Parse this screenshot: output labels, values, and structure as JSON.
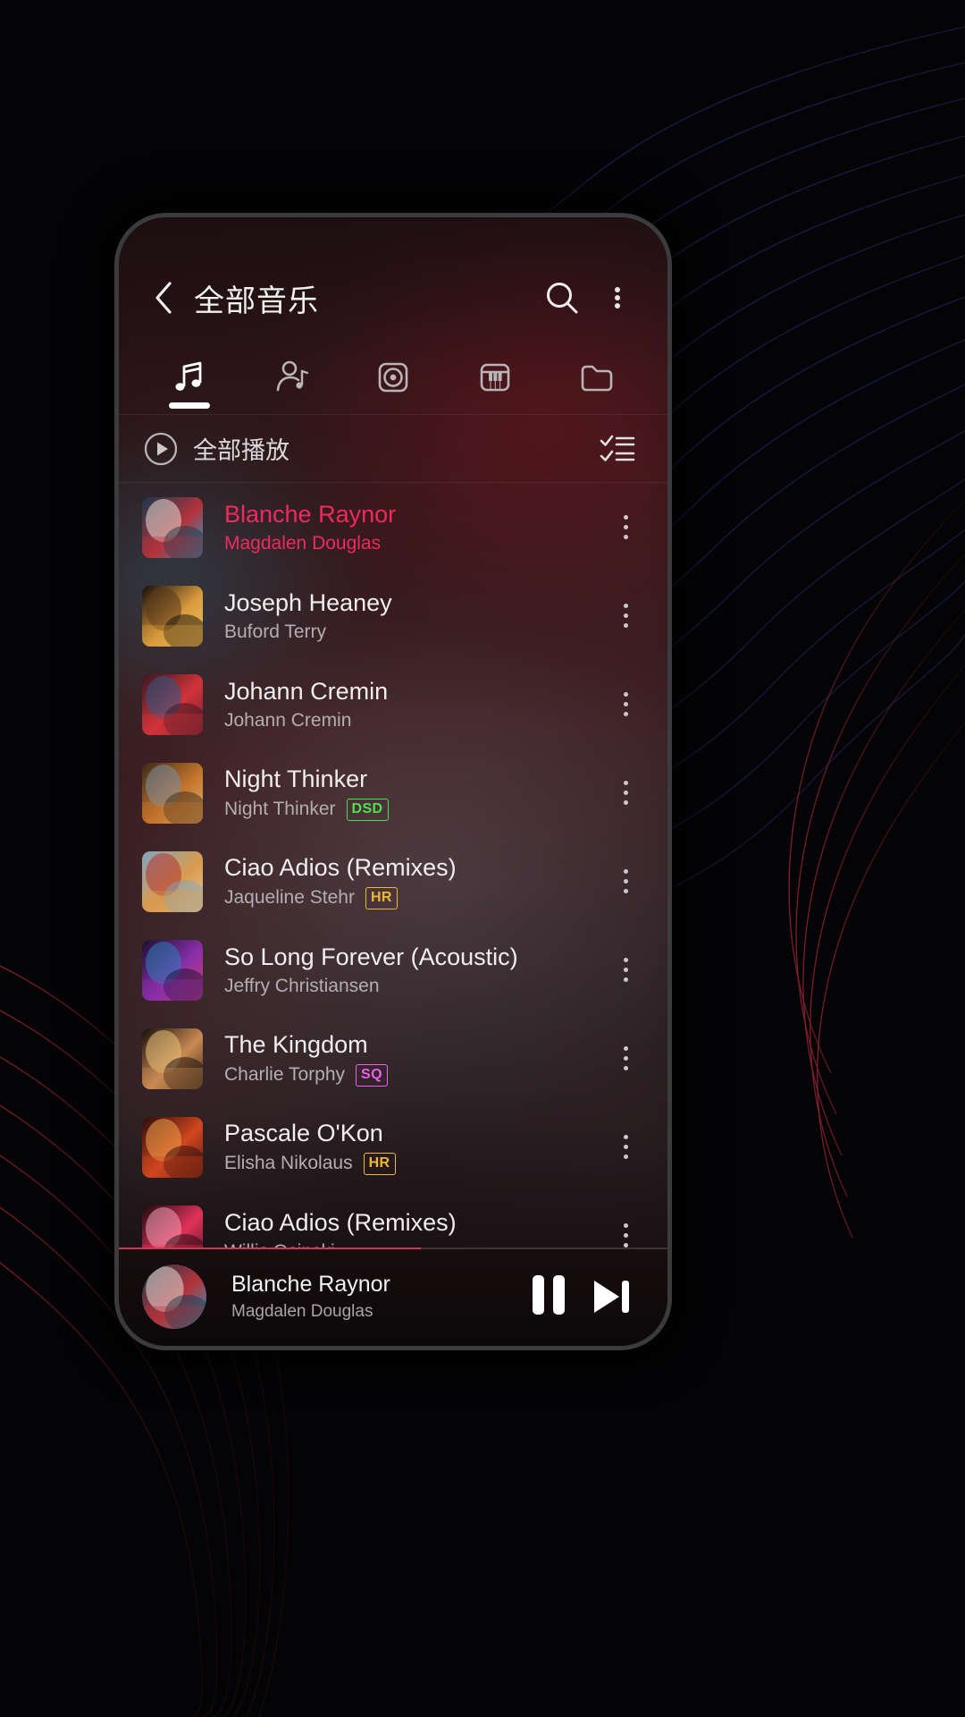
{
  "background": {
    "style_name": "topographic-contour-lines",
    "base_color": "#050507",
    "contour_colors": [
      "#2a2f6e",
      "#7a1f2c"
    ]
  },
  "phone": {
    "frame_color": "#3b3b3e",
    "screen_bg": "#1a1012"
  },
  "header": {
    "back_icon": "chevron-left-icon",
    "title": "全部音乐",
    "search_icon": "search-icon",
    "overflow_icon": "kebab-menu-icon"
  },
  "tabs": [
    {
      "name": "songs",
      "icon": "music-note-icon",
      "active": true
    },
    {
      "name": "artists",
      "icon": "artist-icon",
      "active": false
    },
    {
      "name": "albums",
      "icon": "album-disc-icon",
      "active": false
    },
    {
      "name": "genres",
      "icon": "piano-keys-icon",
      "active": false
    },
    {
      "name": "folders",
      "icon": "folder-icon",
      "active": false
    }
  ],
  "play_all": {
    "icon": "play-circle-icon",
    "label": "全部播放",
    "multiselect_icon": "checklist-icon"
  },
  "songs": [
    {
      "title": "Blanche Raynor",
      "artist": "Magdalen Douglas",
      "badge": "",
      "playing": true,
      "art": {
        "c1": "#17384b",
        "c2": "#b3333c",
        "c3": "#e8dcd6",
        "c4": "#20a2c8"
      }
    },
    {
      "title": "Joseph Heaney",
      "artist": "Buford Terry",
      "badge": "",
      "playing": false,
      "art": {
        "c1": "#120d0a",
        "c2": "#d89a3c",
        "c3": "#5d3a1c",
        "c4": "#f2c866"
      }
    },
    {
      "title": "Johann Cremin",
      "artist": "Johann Cremin",
      "badge": "",
      "playing": false,
      "art": {
        "c1": "#3a1620",
        "c2": "#d2333a",
        "c3": "#2a5b86",
        "c4": "#6e2230"
      }
    },
    {
      "title": "Night Thinker",
      "artist": "Night Thinker",
      "badge": "DSD",
      "playing": false,
      "art": {
        "c1": "#3b2a18",
        "c2": "#c4742c",
        "c3": "#7d8fa0",
        "c4": "#e0b471"
      }
    },
    {
      "title": "Ciao Adios (Remixes)",
      "artist": "Jaqueline Stehr",
      "badge": "HR",
      "playing": false,
      "art": {
        "c1": "#7fa6bd",
        "c2": "#d99a4e",
        "c3": "#b5332f",
        "c4": "#e4c79a"
      }
    },
    {
      "title": "So Long Forever (Acoustic)",
      "artist": "Jeffry Christiansen",
      "badge": "",
      "playing": false,
      "art": {
        "c1": "#1a1030",
        "c2": "#8a2fa8",
        "c3": "#2c7fb8",
        "c4": "#d2416a"
      }
    },
    {
      "title": "The Kingdom",
      "artist": "Charlie Torphy",
      "badge": "SQ",
      "playing": false,
      "art": {
        "c1": "#150d0a",
        "c2": "#c98a52",
        "c3": "#e8c27a",
        "c4": "#3a2418"
      }
    },
    {
      "title": "Pascale O'Kon",
      "artist": "Elisha Nikolaus",
      "badge": "HR",
      "playing": false,
      "art": {
        "c1": "#2a0c0a",
        "c2": "#d0461f",
        "c3": "#f0a24a",
        "c4": "#5c1a10"
      }
    },
    {
      "title": "Ciao Adios (Remixes)",
      "artist": "Willis Osinski",
      "badge": "",
      "playing": false,
      "art": {
        "c1": "#1c0a10",
        "c2": "#e0325a",
        "c3": "#f2a0b4",
        "c4": "#58141f"
      }
    }
  ],
  "mini_player": {
    "title": "Blanche Raynor",
    "artist": "Magdalen Douglas",
    "pause_icon": "pause-icon",
    "next_icon": "skip-next-icon",
    "progress_percent": 55,
    "progress_color": "#d2364f",
    "art": {
      "c1": "#17384b",
      "c2": "#b3333c",
      "c3": "#e8dcd6",
      "c4": "#20a2c8"
    }
  },
  "accent_colors": {
    "playing_text": "#f0295e",
    "badge_dsd": "#4fe04f",
    "badge_hr": "#efb733",
    "badge_sq": "#ef5fef"
  }
}
